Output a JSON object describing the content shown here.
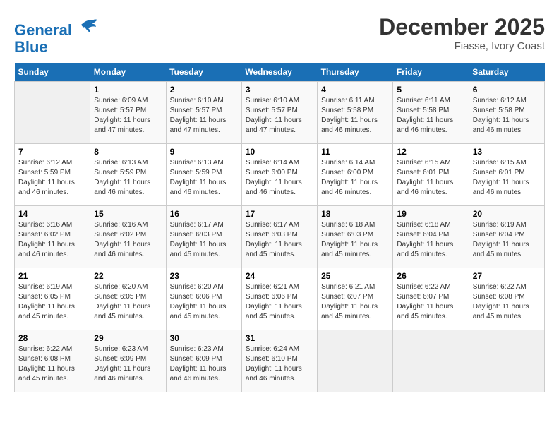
{
  "header": {
    "logo_line1": "General",
    "logo_line2": "Blue",
    "month": "December 2025",
    "location": "Fiasse, Ivory Coast"
  },
  "days_of_week": [
    "Sunday",
    "Monday",
    "Tuesday",
    "Wednesday",
    "Thursday",
    "Friday",
    "Saturday"
  ],
  "weeks": [
    [
      {
        "num": "",
        "info": ""
      },
      {
        "num": "1",
        "info": "Sunrise: 6:09 AM\nSunset: 5:57 PM\nDaylight: 11 hours\nand 47 minutes."
      },
      {
        "num": "2",
        "info": "Sunrise: 6:10 AM\nSunset: 5:57 PM\nDaylight: 11 hours\nand 47 minutes."
      },
      {
        "num": "3",
        "info": "Sunrise: 6:10 AM\nSunset: 5:57 PM\nDaylight: 11 hours\nand 47 minutes."
      },
      {
        "num": "4",
        "info": "Sunrise: 6:11 AM\nSunset: 5:58 PM\nDaylight: 11 hours\nand 46 minutes."
      },
      {
        "num": "5",
        "info": "Sunrise: 6:11 AM\nSunset: 5:58 PM\nDaylight: 11 hours\nand 46 minutes."
      },
      {
        "num": "6",
        "info": "Sunrise: 6:12 AM\nSunset: 5:58 PM\nDaylight: 11 hours\nand 46 minutes."
      }
    ],
    [
      {
        "num": "7",
        "info": "Sunrise: 6:12 AM\nSunset: 5:59 PM\nDaylight: 11 hours\nand 46 minutes."
      },
      {
        "num": "8",
        "info": "Sunrise: 6:13 AM\nSunset: 5:59 PM\nDaylight: 11 hours\nand 46 minutes."
      },
      {
        "num": "9",
        "info": "Sunrise: 6:13 AM\nSunset: 5:59 PM\nDaylight: 11 hours\nand 46 minutes."
      },
      {
        "num": "10",
        "info": "Sunrise: 6:14 AM\nSunset: 6:00 PM\nDaylight: 11 hours\nand 46 minutes."
      },
      {
        "num": "11",
        "info": "Sunrise: 6:14 AM\nSunset: 6:00 PM\nDaylight: 11 hours\nand 46 minutes."
      },
      {
        "num": "12",
        "info": "Sunrise: 6:15 AM\nSunset: 6:01 PM\nDaylight: 11 hours\nand 46 minutes."
      },
      {
        "num": "13",
        "info": "Sunrise: 6:15 AM\nSunset: 6:01 PM\nDaylight: 11 hours\nand 46 minutes."
      }
    ],
    [
      {
        "num": "14",
        "info": "Sunrise: 6:16 AM\nSunset: 6:02 PM\nDaylight: 11 hours\nand 46 minutes."
      },
      {
        "num": "15",
        "info": "Sunrise: 6:16 AM\nSunset: 6:02 PM\nDaylight: 11 hours\nand 46 minutes."
      },
      {
        "num": "16",
        "info": "Sunrise: 6:17 AM\nSunset: 6:03 PM\nDaylight: 11 hours\nand 45 minutes."
      },
      {
        "num": "17",
        "info": "Sunrise: 6:17 AM\nSunset: 6:03 PM\nDaylight: 11 hours\nand 45 minutes."
      },
      {
        "num": "18",
        "info": "Sunrise: 6:18 AM\nSunset: 6:03 PM\nDaylight: 11 hours\nand 45 minutes."
      },
      {
        "num": "19",
        "info": "Sunrise: 6:18 AM\nSunset: 6:04 PM\nDaylight: 11 hours\nand 45 minutes."
      },
      {
        "num": "20",
        "info": "Sunrise: 6:19 AM\nSunset: 6:04 PM\nDaylight: 11 hours\nand 45 minutes."
      }
    ],
    [
      {
        "num": "21",
        "info": "Sunrise: 6:19 AM\nSunset: 6:05 PM\nDaylight: 11 hours\nand 45 minutes."
      },
      {
        "num": "22",
        "info": "Sunrise: 6:20 AM\nSunset: 6:05 PM\nDaylight: 11 hours\nand 45 minutes."
      },
      {
        "num": "23",
        "info": "Sunrise: 6:20 AM\nSunset: 6:06 PM\nDaylight: 11 hours\nand 45 minutes."
      },
      {
        "num": "24",
        "info": "Sunrise: 6:21 AM\nSunset: 6:06 PM\nDaylight: 11 hours\nand 45 minutes."
      },
      {
        "num": "25",
        "info": "Sunrise: 6:21 AM\nSunset: 6:07 PM\nDaylight: 11 hours\nand 45 minutes."
      },
      {
        "num": "26",
        "info": "Sunrise: 6:22 AM\nSunset: 6:07 PM\nDaylight: 11 hours\nand 45 minutes."
      },
      {
        "num": "27",
        "info": "Sunrise: 6:22 AM\nSunset: 6:08 PM\nDaylight: 11 hours\nand 45 minutes."
      }
    ],
    [
      {
        "num": "28",
        "info": "Sunrise: 6:22 AM\nSunset: 6:08 PM\nDaylight: 11 hours\nand 45 minutes."
      },
      {
        "num": "29",
        "info": "Sunrise: 6:23 AM\nSunset: 6:09 PM\nDaylight: 11 hours\nand 46 minutes."
      },
      {
        "num": "30",
        "info": "Sunrise: 6:23 AM\nSunset: 6:09 PM\nDaylight: 11 hours\nand 46 minutes."
      },
      {
        "num": "31",
        "info": "Sunrise: 6:24 AM\nSunset: 6:10 PM\nDaylight: 11 hours\nand 46 minutes."
      },
      {
        "num": "",
        "info": ""
      },
      {
        "num": "",
        "info": ""
      },
      {
        "num": "",
        "info": ""
      }
    ]
  ]
}
